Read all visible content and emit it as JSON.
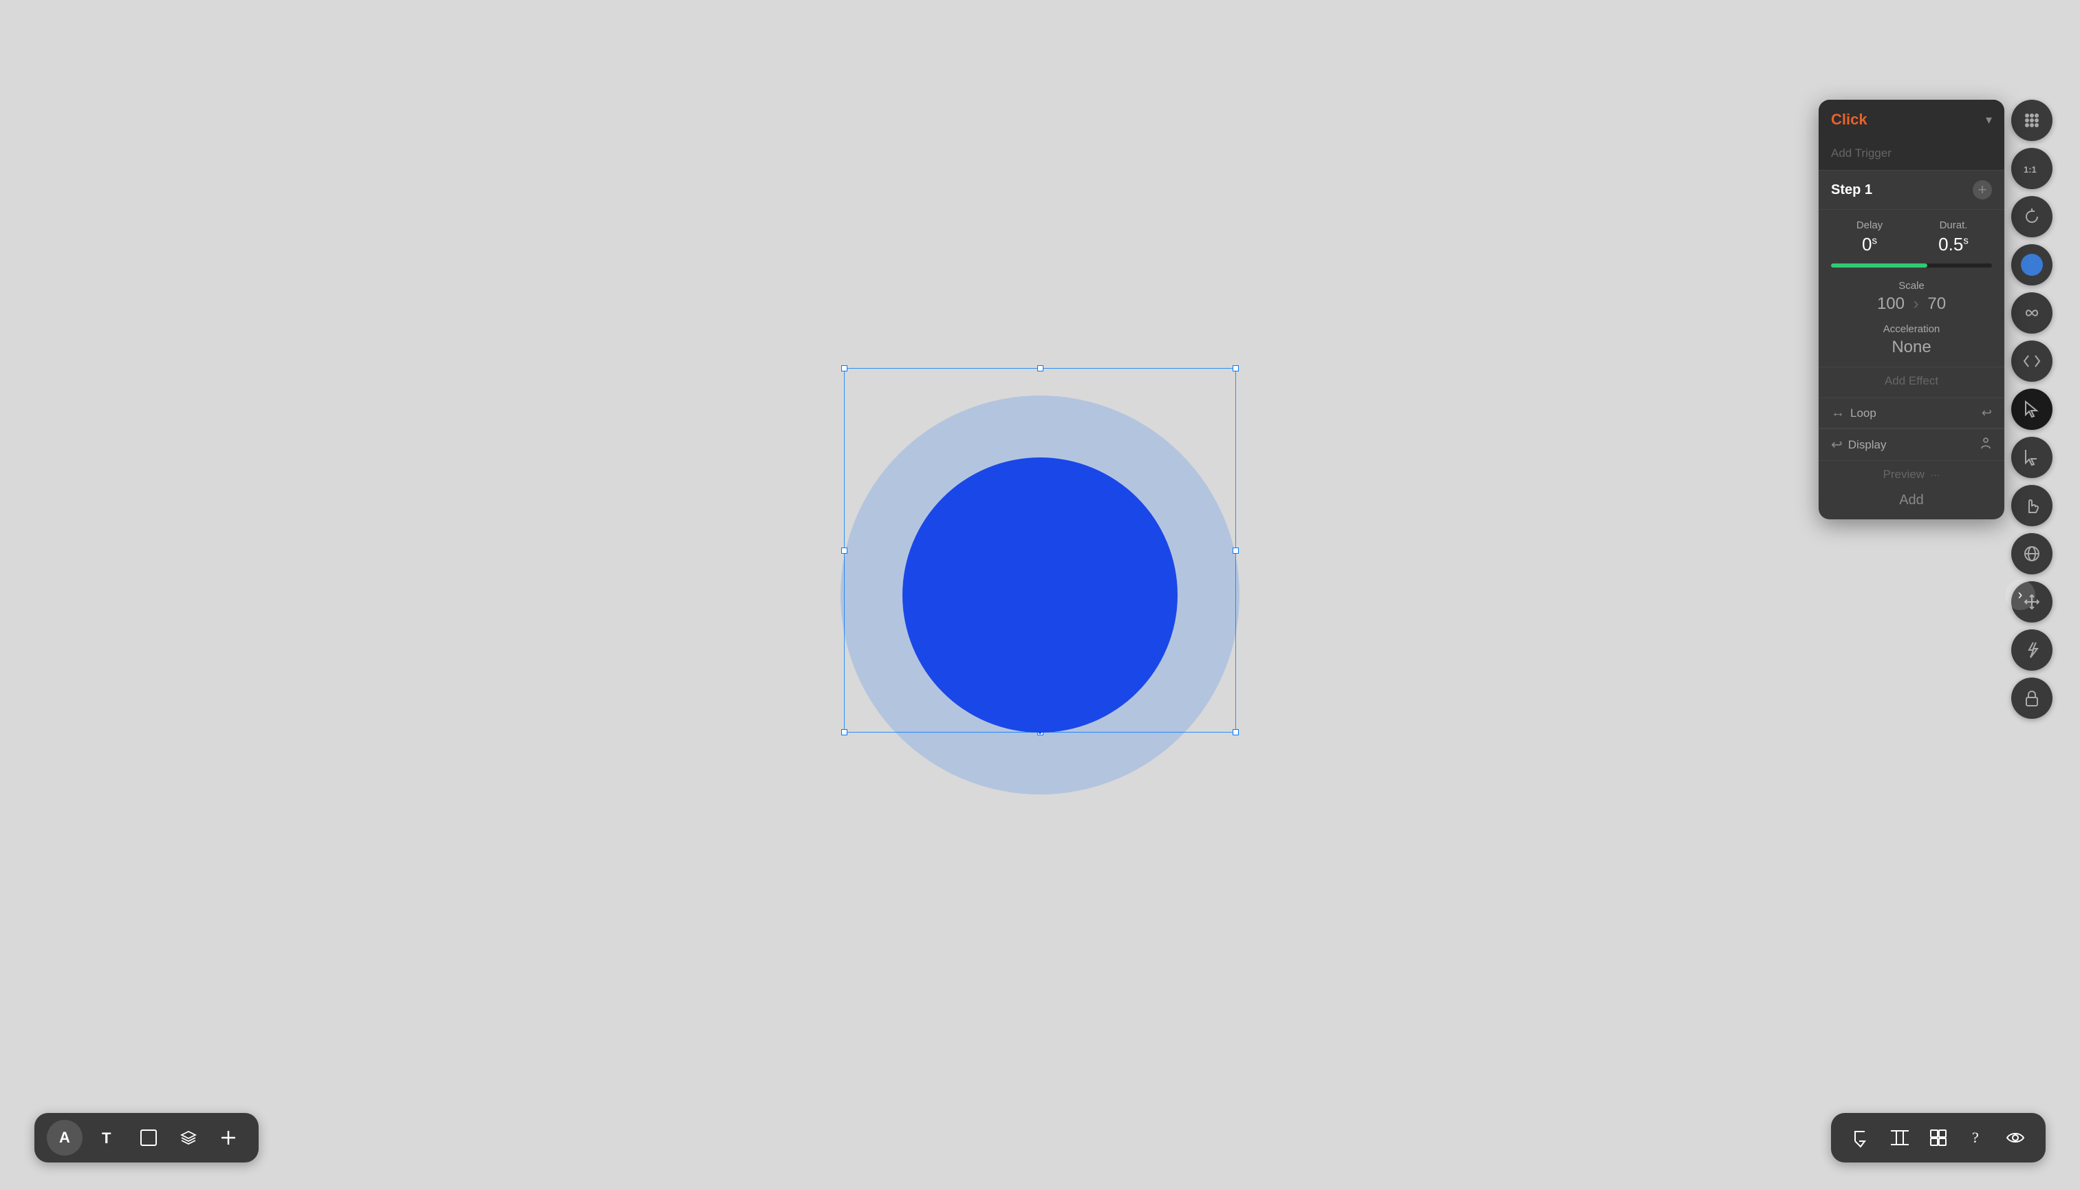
{
  "canvas": {
    "bg_color": "#d9d9d9"
  },
  "bottom_toolbar": {
    "avatar_label": "A",
    "text_tool_label": "T",
    "frame_tool_label": "frame",
    "layers_tool_label": "layers",
    "add_tool_label": "+"
  },
  "bottom_right_toolbar": {
    "select_label": "select",
    "columns_label": "columns",
    "layout_label": "layout",
    "help_label": "?",
    "eye_label": "eye"
  },
  "right_panel": {
    "trigger": {
      "label": "Click",
      "chevron": "▾",
      "add_trigger_placeholder": "Add Trigger"
    },
    "step": {
      "title": "Step 1",
      "add_icon": "+"
    },
    "delay": {
      "label": "Delay",
      "value": "0",
      "unit": "s"
    },
    "duration": {
      "label": "Durat.",
      "value": "0.5",
      "unit": "s"
    },
    "progress_fill_percent": 60,
    "scale": {
      "label": "Scale",
      "value_x": "100",
      "separator": "›",
      "value_y": "70"
    },
    "acceleration": {
      "label": "Acceleration",
      "value": "None"
    },
    "add_effect": {
      "label": "Add Effect"
    },
    "loop": {
      "label": "Loop",
      "left_icon": "↔",
      "right_icon": "↩"
    },
    "display": {
      "label": "Display",
      "left_icon": "↩",
      "right_icon": "person"
    },
    "preview": {
      "label": "Preview",
      "dots": "···"
    },
    "add": {
      "label": "Add"
    }
  },
  "right_sidebar_icons": [
    {
      "name": "grid-icon",
      "label": "grid"
    },
    {
      "name": "one-to-one-icon",
      "label": "1:1"
    },
    {
      "name": "refresh-icon",
      "label": "refresh"
    },
    {
      "name": "circle-icon",
      "label": "circle",
      "active": true
    },
    {
      "name": "infinity-icon",
      "label": "infinity"
    },
    {
      "name": "code-icon",
      "label": "code"
    },
    {
      "name": "cursor-icon",
      "label": "cursor",
      "active_black": true
    },
    {
      "name": "arrow-icon",
      "label": "arrow"
    },
    {
      "name": "hand-icon",
      "label": "hand"
    },
    {
      "name": "sphere-icon",
      "label": "sphere"
    },
    {
      "name": "move-icon",
      "label": "move"
    },
    {
      "name": "lightning-icon",
      "label": "lightning"
    },
    {
      "name": "lock-icon",
      "label": "lock"
    }
  ],
  "arrow_nav": {
    "label": "›"
  }
}
